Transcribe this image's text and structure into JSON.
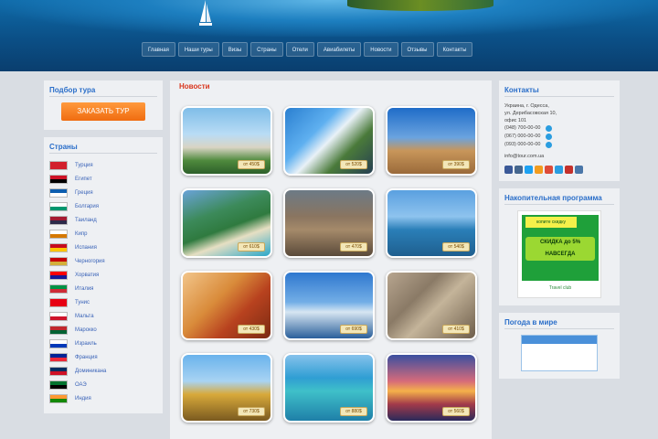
{
  "header": {
    "nav": [
      "Главная",
      "Наши туры",
      "Визы",
      "Страны",
      "Отели",
      "Авиабилеты",
      "Новости",
      "Отзывы",
      "Контакты"
    ]
  },
  "left": {
    "order_title": "Подбор тура",
    "order_button": "ЗАКАЗАТЬ ТУР",
    "countries_title": "Страны",
    "countries": [
      {
        "name": "Турция",
        "flag": [
          "#d21f2b",
          "#d21f2b"
        ]
      },
      {
        "name": "Египет",
        "flag": [
          "#ce1126",
          "#000000"
        ]
      },
      {
        "name": "Греция",
        "flag": [
          "#0d5eaf",
          "#ffffff"
        ]
      },
      {
        "name": "Болгария",
        "flag": [
          "#ffffff",
          "#00966e"
        ]
      },
      {
        "name": "Таиланд",
        "flag": [
          "#a51931",
          "#2d2a4a"
        ]
      },
      {
        "name": "Кипр",
        "flag": [
          "#ffffff",
          "#d57800"
        ]
      },
      {
        "name": "Испания",
        "flag": [
          "#c60b1e",
          "#ffc400"
        ]
      },
      {
        "name": "Черногория",
        "flag": [
          "#c40308",
          "#d4af3a"
        ]
      },
      {
        "name": "Хорватия",
        "flag": [
          "#ff0000",
          "#171796"
        ]
      },
      {
        "name": "Италия",
        "flag": [
          "#009246",
          "#ce2b37"
        ]
      },
      {
        "name": "Тунис",
        "flag": [
          "#e70013",
          "#e70013"
        ]
      },
      {
        "name": "Мальта",
        "flag": [
          "#ffffff",
          "#cf142b"
        ]
      },
      {
        "name": "Марокко",
        "flag": [
          "#c1272d",
          "#006233"
        ]
      },
      {
        "name": "Израиль",
        "flag": [
          "#ffffff",
          "#0038b8"
        ]
      },
      {
        "name": "Франция",
        "flag": [
          "#002395",
          "#ed2939"
        ]
      },
      {
        "name": "Доминикана",
        "flag": [
          "#002d62",
          "#ce1126"
        ]
      },
      {
        "name": "ОАЭ",
        "flag": [
          "#00732f",
          "#000000"
        ]
      },
      {
        "name": "Индия",
        "flag": [
          "#ff9933",
          "#138808"
        ]
      }
    ]
  },
  "main": {
    "title": "Новости",
    "tiles": [
      {
        "class": "t1",
        "price": "от 450$"
      },
      {
        "class": "t2",
        "price": "от 520$"
      },
      {
        "class": "t3",
        "price": "от 390$"
      },
      {
        "class": "t4",
        "price": "от 610$"
      },
      {
        "class": "t5",
        "price": "от 470$"
      },
      {
        "class": "t6",
        "price": "от 540$"
      },
      {
        "class": "t7",
        "price": "от 430$"
      },
      {
        "class": "t8",
        "price": "от 690$"
      },
      {
        "class": "t9",
        "price": "от 410$"
      },
      {
        "class": "t10",
        "price": "от 730$"
      },
      {
        "class": "t11",
        "price": "от 880$"
      },
      {
        "class": "t12",
        "price": "от 560$"
      }
    ]
  },
  "right": {
    "contacts_title": "Контакты",
    "address": [
      "Украина, г. Одесса,",
      "ул. Дерибасовская 10,",
      "офис 101"
    ],
    "phones": [
      "(048) 700-00-00",
      "(067) 000-00-00",
      "(093) 000-00-00"
    ],
    "email_line": "info@tour.com.ua",
    "social_colors": [
      "#3b5998",
      "#45668e",
      "#1da1f2",
      "#f29c1f",
      "#dd4b39",
      "#2a9de0",
      "#c4302b",
      "#4a76a8"
    ],
    "banner_title": "Накопительная программа",
    "banner": {
      "top": "копите скидку",
      "main": "СКИДКА до 5% НАВСЕГДА",
      "footer": "Travel club"
    },
    "calendar_title": "Погода в мире"
  }
}
